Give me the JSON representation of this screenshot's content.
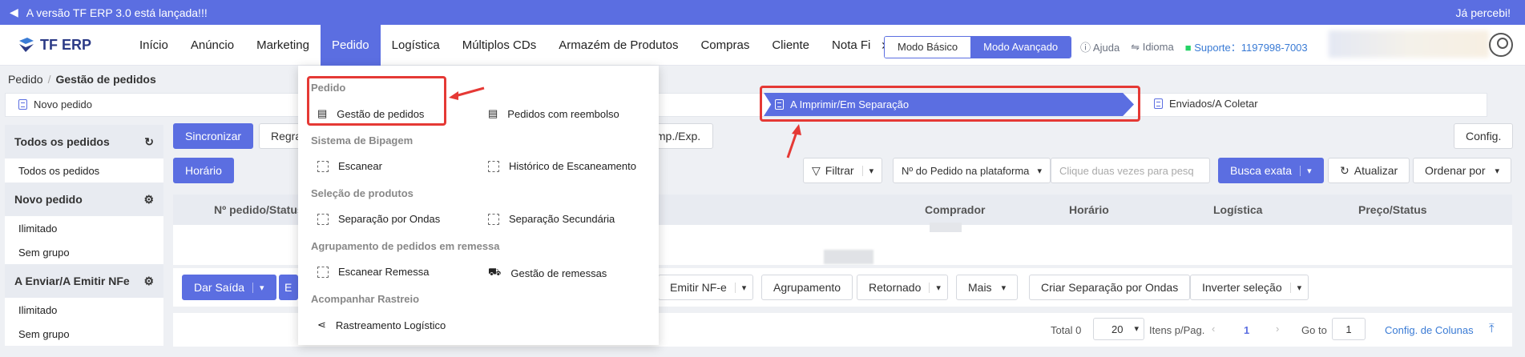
{
  "banner": {
    "text": "A versão TF ERP 3.0 está lançada!!!",
    "right": "Já percebi!"
  },
  "logo": "TF ERP",
  "nav": [
    "Início",
    "Anúncio",
    "Marketing",
    "Pedido",
    "Logística",
    "Múltiplos CDs",
    "Armazém de Produtos",
    "Compras",
    "Cliente",
    "Nota Fisc"
  ],
  "modes": {
    "basic": "Modo Básico",
    "advanced": "Modo Avançado"
  },
  "util": {
    "help": "Ajuda",
    "lang": "Idioma",
    "support": "Suporte：1197998-7003"
  },
  "breadcrumb": {
    "root": "Pedido",
    "current": "Gestão de pedidos"
  },
  "flow": {
    "step1": "Novo pedido",
    "step2": "A Imprimir/Em Separação",
    "step3": "Enviados/A Coletar"
  },
  "sidebar": {
    "all": "Todos os pedidos",
    "all_item": "Todos os pedidos",
    "new": "Novo pedido",
    "new_items": [
      "Ilimitado",
      "Sem grupo"
    ],
    "toship": "A Enviar/A Emitir NFe",
    "toship_items": [
      "Ilimitado",
      "Sem grupo"
    ]
  },
  "toolbar": {
    "sync": "Sincronizar",
    "rules": "Regra",
    "impexp": "Imp./Exp.",
    "config": "Config.",
    "time": "Horário",
    "filter": "Filtrar",
    "search_type": "Nº do Pedido na plataforma",
    "search_placeholder": "Clique duas vezes para pesq",
    "exact": "Busca exata",
    "refresh": "Atualizar",
    "order_by": "Ordenar por"
  },
  "table": {
    "cols": [
      "Nº pedido/Status",
      "Comprador",
      "Horário",
      "Logística",
      "Preço/Status"
    ]
  },
  "actions": {
    "ship": "Dar Saída",
    "b": "E",
    "nfe": "Emitir NF-e",
    "group": "Agrupamento",
    "returned": "Retornado",
    "more": "Mais",
    "wave": "Criar Separação por Ondas",
    "invert": "Inverter seleção"
  },
  "pager": {
    "total": "Total 0",
    "size": "20",
    "per_page": "Itens p/Pag.",
    "page": "1",
    "goto": "Go to",
    "goto_val": "1",
    "colconfig": "Config. de Colunas"
  },
  "menu": {
    "h1": "Pedido",
    "orders": "Gestão de pedidos",
    "refund": "Pedidos com reembolso",
    "h2": "Sistema de Bipagem",
    "scan": "Escanear",
    "scan_hist": "Histórico de Escaneamento",
    "h3": "Seleção de produtos",
    "wave": "Separação por Ondas",
    "secondary": "Separação Secundária",
    "h4": "Agrupamento de pedidos em remessa",
    "scan_batch": "Escanear Remessa",
    "batch_mgmt": "Gestão de remessas",
    "h5": "Acompanhar Rastreio",
    "tracking": "Rastreamento Logístico"
  },
  "colors": {
    "primary": "#5b6ee1",
    "highlight": "#e53935"
  }
}
